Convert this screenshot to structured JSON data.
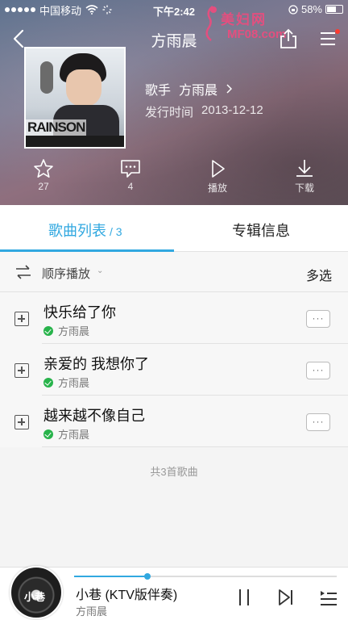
{
  "status_bar": {
    "carrier": "中国移动",
    "time": "下午2:42",
    "battery": "58%"
  },
  "watermark": {
    "text": "美妇网",
    "url": "MF08.com"
  },
  "nav": {
    "title": "方雨晨"
  },
  "album": {
    "cover_text": "RAINSON",
    "singer_label": "歌手",
    "singer_name": "方雨晨",
    "release_label": "发行时间",
    "release_date": "2013-12-12"
  },
  "actions": {
    "favorite_count": "27",
    "comment_count": "4",
    "play_label": "播放",
    "download_label": "下载"
  },
  "tabs": {
    "songs_label": "歌曲列表",
    "songs_count": "/ 3",
    "info_label": "专辑信息"
  },
  "toolbar": {
    "order_label": "顺序播放",
    "multi_select_label": "多选"
  },
  "songs": [
    {
      "title": "快乐给了你",
      "artist": "方雨晨"
    },
    {
      "title": "亲爱的 我想你了",
      "artist": "方雨晨"
    },
    {
      "title": "越来越不像自己",
      "artist": "方雨晨"
    }
  ],
  "total_text": "共3首歌曲",
  "player": {
    "disc_text": "小巷",
    "title": "小巷 (KTV版伴奏)",
    "artist": "方雨晨",
    "progress": 0.28
  },
  "colors": {
    "accent": "#31a8e0",
    "ok_green": "#28b34b",
    "watermark_pink": "#e34f7f"
  }
}
